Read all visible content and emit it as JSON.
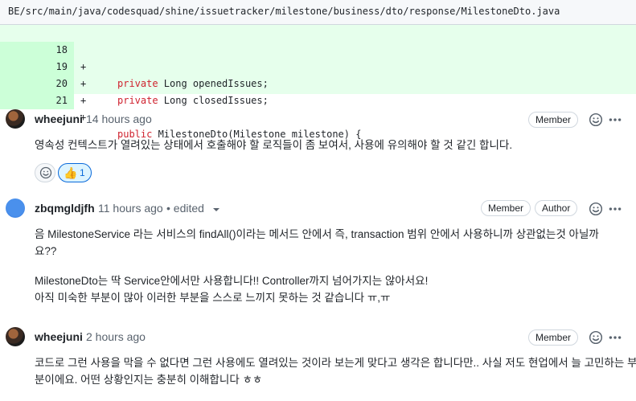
{
  "file": {
    "path": "BE/src/main/java/codesquad/shine/issuetracker/milestone/business/dto/response/MilestoneDto.java"
  },
  "diff": {
    "lines": [
      {
        "num": "18",
        "sign": "+",
        "code_kw": "private",
        "code_rest": " Long openedIssues;"
      },
      {
        "num": "19",
        "sign": "+",
        "code_kw": "private",
        "code_rest": " Long closedIssues;"
      },
      {
        "num": "20",
        "sign": "+",
        "code_kw": "",
        "code_rest": ""
      },
      {
        "num": "21",
        "sign": "+",
        "code_kw": "public",
        "code_rest": " MilestoneDto(Milestone milestone) {"
      }
    ]
  },
  "comments": [
    {
      "author": "wheejuni",
      "time": "14 hours ago",
      "badge": "Member",
      "lines": [
        "영속성 컨텍스트가 열려있는 상태에서 호출해야 할 로직들이 좀 보여서, 사용에 유의해야 할 것 같긴 합니다."
      ],
      "reaction": {
        "emoji": "👍",
        "count": "1"
      }
    },
    {
      "author": "zbqmgldjfh",
      "time": "11 hours ago",
      "edited": "• edited",
      "badge": "Member",
      "badge2": "Author",
      "lines": [
        "음 MilestoneService 라는 서비스의 findAll()이라는 메서드 안에서 즉, transaction 범위 안에서 사용하니까 상관없는것 아닐까",
        "요??",
        "MilestoneDto는 딱 Service안에서만 사용합니다!! Controller까지 넘어가지는 않아서요!",
        "아직 미숙한 부분이 많아 이러한 부분을 스스로 느끼지 못하는 것 같습니다 ㅠ,ㅠ"
      ]
    },
    {
      "author": "wheejuni",
      "time": "2 hours ago",
      "badge": "Member",
      "lines": [
        "코드로 그런 사용을 막을 수 없다면 그런 사용에도 열려있는 것이라 보는게 맞다고 생각은 합니다만.. 사실 저도 현업에서 늘 고민하는 부",
        "분이에요. 어떤 상황인지는 충분히 이해합니다 ㅎㅎ"
      ]
    }
  ],
  "icons": {
    "emoji": "smiley-icon",
    "more": "kebab-horizontal-icon"
  }
}
